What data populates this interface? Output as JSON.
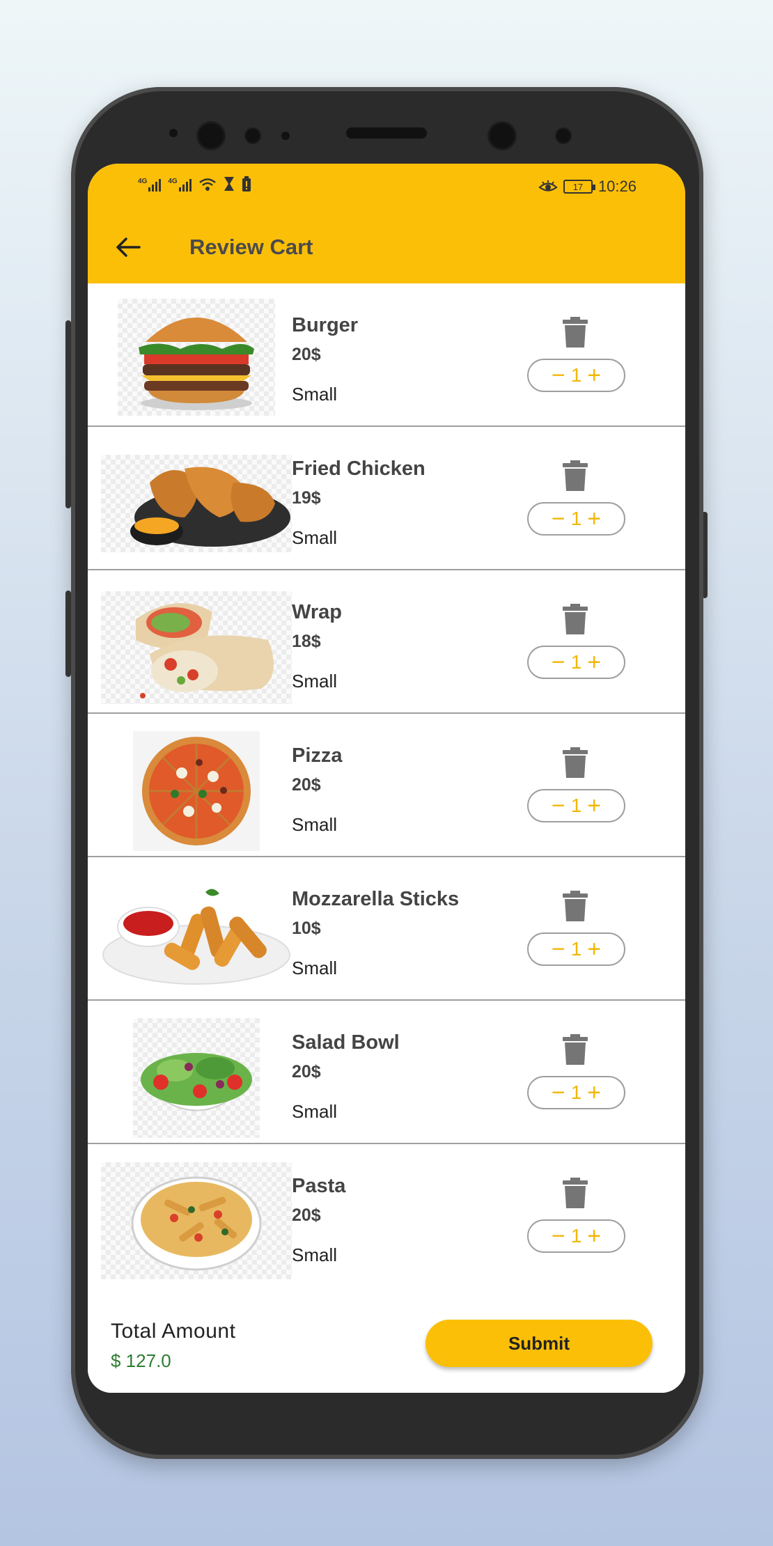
{
  "status_bar": {
    "network_1": "4G",
    "network_2": "4G",
    "battery": "17",
    "time": "10:26"
  },
  "header": {
    "title": "Review Cart",
    "back_icon": "arrow-left-icon"
  },
  "cart_items": [
    {
      "name": "Burger",
      "price": "20$",
      "size": "Small",
      "quantity": "1"
    },
    {
      "name": "Fried Chicken",
      "price": "19$",
      "size": "Small",
      "quantity": "1"
    },
    {
      "name": "Wrap",
      "price": "18$",
      "size": "Small",
      "quantity": "1"
    },
    {
      "name": "Pizza",
      "price": "20$",
      "size": "Small",
      "quantity": "1"
    },
    {
      "name": "Mozzarella Sticks",
      "price": "10$",
      "size": "Small",
      "quantity": "1"
    },
    {
      "name": "Salad Bowl",
      "price": "20$",
      "size": "Small",
      "quantity": "1"
    },
    {
      "name": "Pasta",
      "price": "20$",
      "size": "Small",
      "quantity": "1"
    }
  ],
  "stepper": {
    "minus": "−",
    "plus": "+"
  },
  "footer": {
    "total_label": "Total Amount",
    "total_value": "$ 127.0",
    "submit_label": "Submit"
  },
  "colors": {
    "accent": "#fcbf07",
    "total_green": "#2e7d32",
    "icon_gray": "#757575"
  }
}
